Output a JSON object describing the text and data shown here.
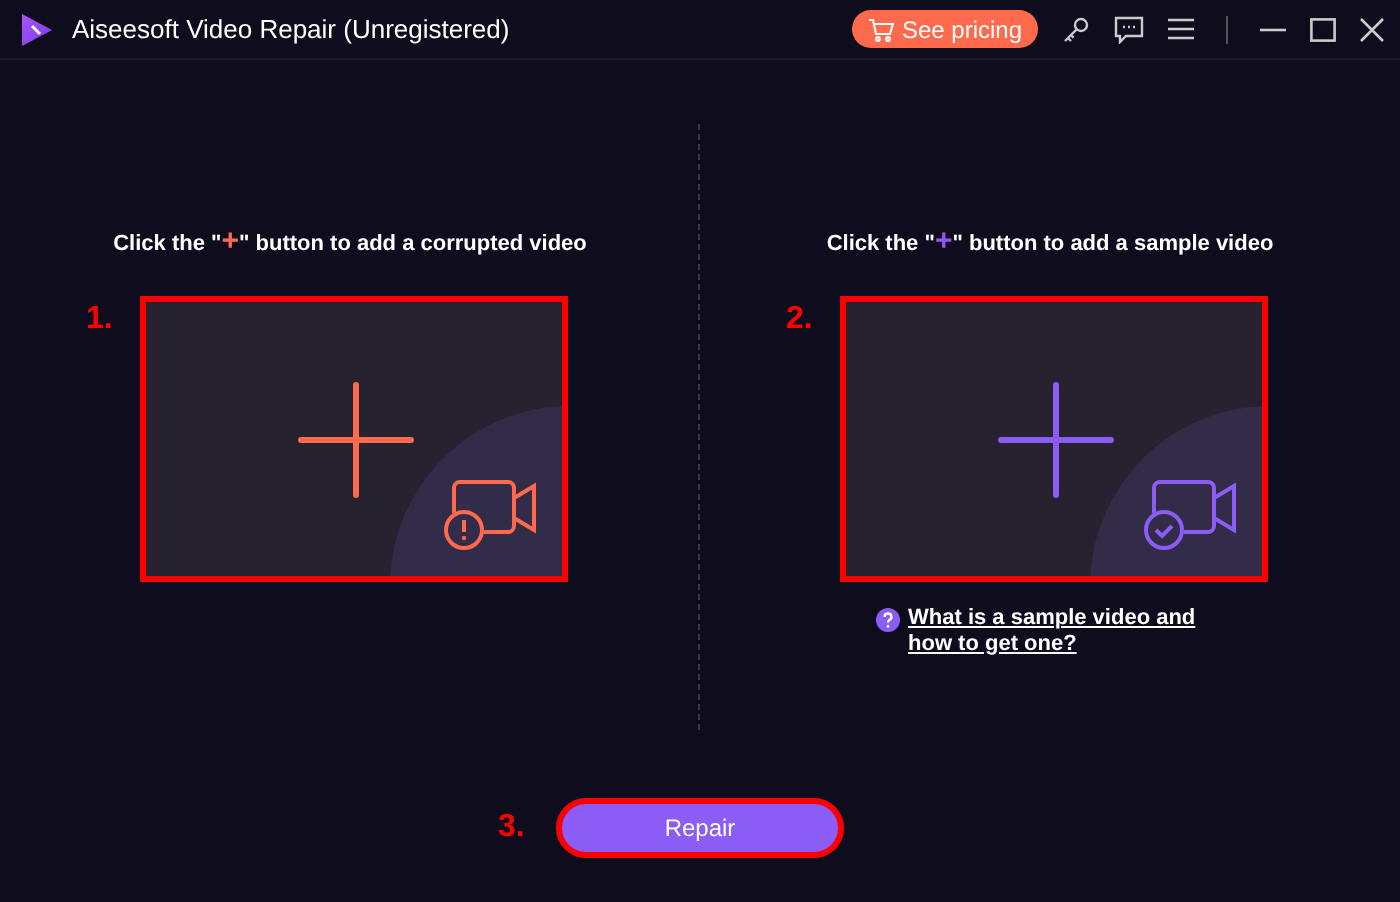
{
  "window": {
    "title": "Aiseesoft Video Repair (Unregistered)",
    "pricing_button": "See pricing"
  },
  "panels": [
    {
      "kind": "corrupted",
      "step": "1.",
      "before": "Click the \"",
      "plus": "+",
      "after": "\" button to add a corrupted video"
    },
    {
      "kind": "sample",
      "step": "2.",
      "before": "Click the \"",
      "plus": "+",
      "after": "\" button to add a sample video",
      "help_link": "What is a sample video and how to get one?"
    }
  ],
  "repair": {
    "step": "3.",
    "label": "Repair"
  }
}
